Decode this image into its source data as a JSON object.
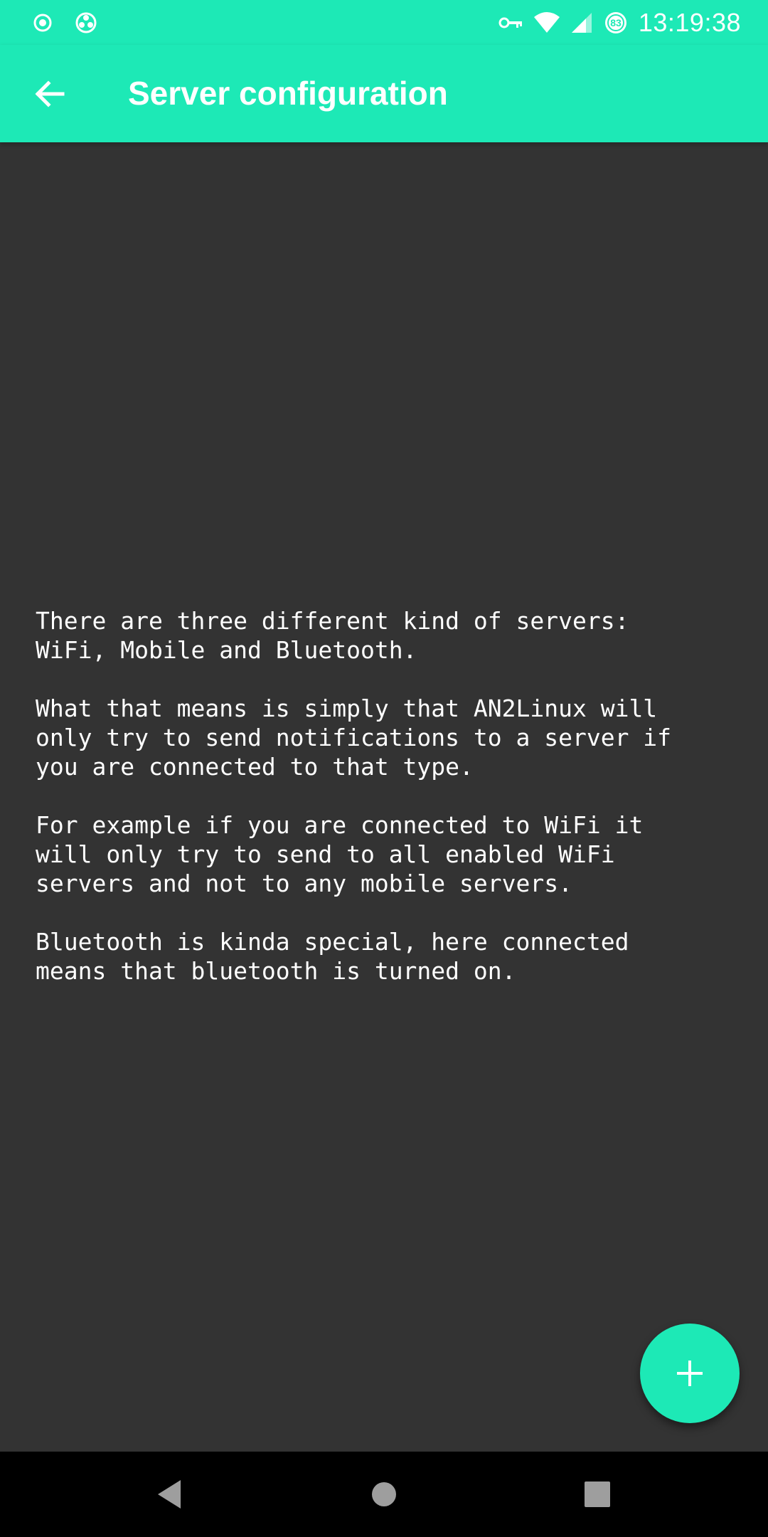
{
  "status_bar": {
    "time": "13:19:38",
    "battery_level": "83",
    "icons": [
      "record-icon",
      "sync-icon",
      "vpn-key-icon",
      "wifi-icon",
      "cell-signal-icon",
      "battery-icon"
    ]
  },
  "app_bar": {
    "title": "Server configuration",
    "back_icon": "arrow-back-icon"
  },
  "content": {
    "paragraphs": [
      "There are three different kind of servers:\nWiFi, Mobile and Bluetooth.",
      "What that means is simply that AN2Linux will\nonly try to send notifications to a server if\nyou are connected to that type.",
      "For example if you are connected to WiFi it\nwill only try to send to all enabled WiFi\nservers and not to any mobile servers.",
      "Bluetooth is kinda special, here connected\nmeans that bluetooth is turned on."
    ]
  },
  "fab": {
    "icon": "plus-icon"
  },
  "nav_bar": {
    "icons": [
      "nav-back-icon",
      "nav-home-icon",
      "nav-recents-icon"
    ]
  },
  "colors": {
    "accent": "#1de9b6",
    "background": "#333333",
    "nav_bar": "#000000",
    "text": "#ffffff"
  }
}
